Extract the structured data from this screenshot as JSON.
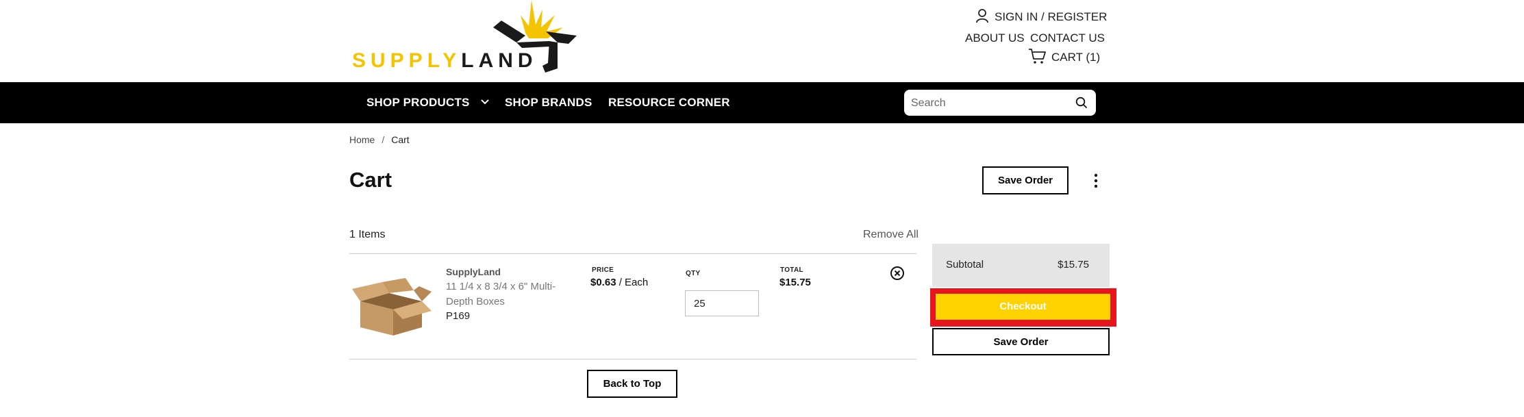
{
  "brand": {
    "logo_text_yellow": "SUPPLY",
    "logo_text_black": "LAND",
    "yellow": "#f5c400",
    "black": "#1a1a1a"
  },
  "header": {
    "sign_in": "SIGN IN / REGISTER",
    "about": "ABOUT US",
    "contact": "CONTACT US",
    "cart": "CART (1)"
  },
  "nav": {
    "shop_products": "SHOP PRODUCTS",
    "shop_brands": "SHOP BRANDS",
    "resource_corner": "RESOURCE CORNER",
    "search_placeholder": "Search"
  },
  "breadcrumb": {
    "home": "Home",
    "sep": "/",
    "current": "Cart"
  },
  "page": {
    "title": "Cart",
    "save_order_top": "Save Order"
  },
  "cart": {
    "items_count": "1 Items",
    "remove_all": "Remove All",
    "item": {
      "brand": "SupplyLand",
      "name": "11 1/4 x 8 3/4 x 6\" Multi-Depth Boxes",
      "sku": "P169",
      "price_label": "PRICE",
      "price_value": "$0.63",
      "price_unit": " / Each",
      "qty_label": "QTY",
      "qty_value": "25",
      "total_label": "TOTAL",
      "total_value": "$15.75"
    },
    "back_to_top": "Back to Top"
  },
  "summary": {
    "subtotal_label": "Subtotal",
    "subtotal_value": "$15.75",
    "checkout": "Checkout",
    "save_order": "Save Order"
  },
  "colors": {
    "nav_bg": "#000000",
    "checkout_bg": "#ffd200",
    "highlight": "#e8141e",
    "summary_bg": "#e5e5e5"
  }
}
